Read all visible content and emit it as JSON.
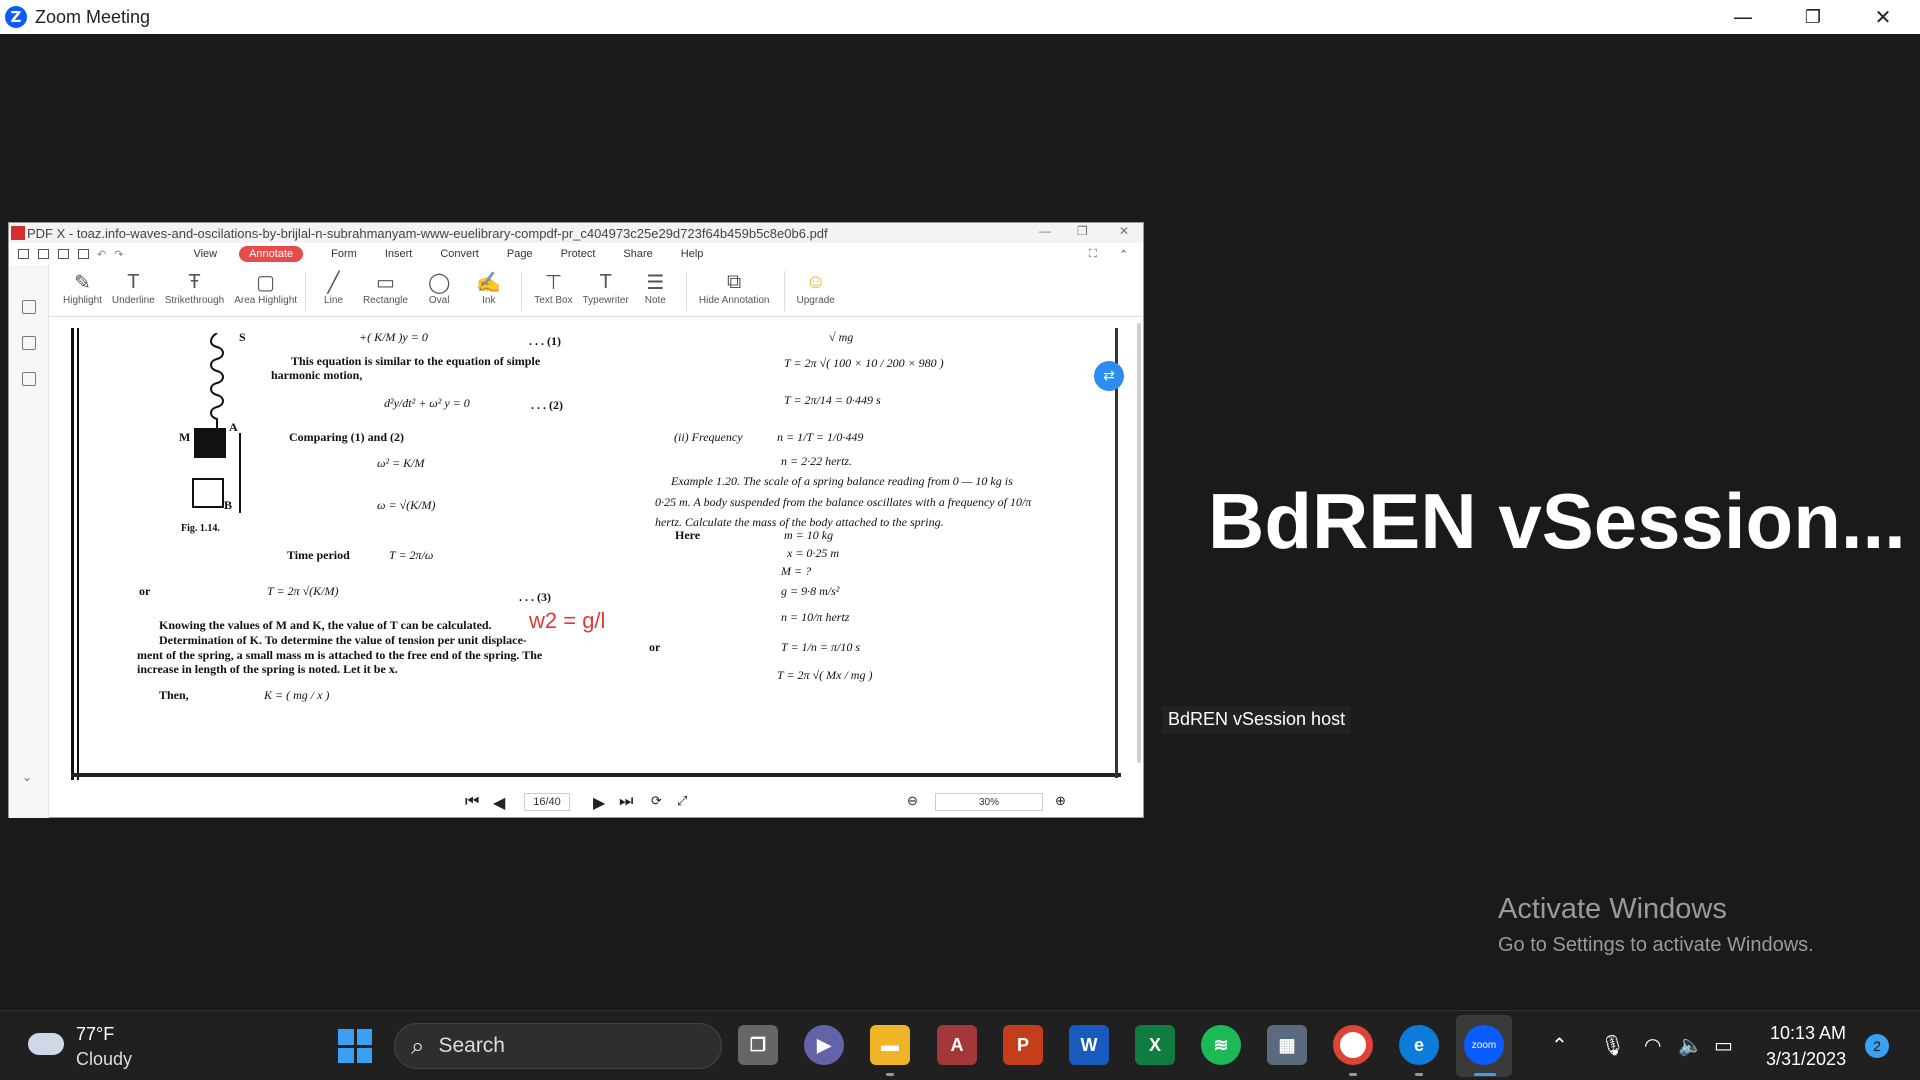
{
  "zoom": {
    "logo": "Z",
    "title": "Zoom Meeting",
    "minimize": "—",
    "restore": "❐",
    "close": "✕"
  },
  "pdf": {
    "title": "PDF X - toaz.info-waves-and-oscilations-by-brijlal-n-subrahmanyam-www-euelibrary-compdf-pr_c404973c25e29d723f64b459b5c8e0b6.pdf",
    "menu": [
      "View",
      "Annotate",
      "Form",
      "Insert",
      "Convert",
      "Page",
      "Protect",
      "Share",
      "Help"
    ],
    "tools": [
      "Highlight",
      "Underline",
      "Strikethrough",
      "Area Highlight",
      "Line",
      "Rectangle",
      "Oval",
      "Ink",
      "Text Box",
      "Typewriter",
      "Note",
      "Hide Annotation",
      "Upgrade"
    ],
    "page_indicator": "16/40",
    "zoom_level": "30%",
    "page": {
      "left": {
        "s_label": "S",
        "eq1_top": "+( K/M )y = 0",
        "eq1_ref": ". . . (1)",
        "line1": "This equation is similar to the equation of simple",
        "line2": "harmonic motion,",
        "eq2": "d²y/dt² + ω² y = 0",
        "eq2_ref": ". . . (2)",
        "m_label": "M",
        "a_label": "A",
        "comparing": "Comparing (1) and (2)",
        "omega_sq": "ω² = K/M",
        "omega": "ω = √(K/M)",
        "b_label": "B",
        "fig": "Fig. 1.14.",
        "time_period": "Time period",
        "t_eq": "T = 2π/ω",
        "or": "or",
        "t_eq2": "T = 2π √(K/M)",
        "eq3_ref": ". . . (3)",
        "handwritten": "w2 = g/l",
        "know": "Knowing the values of M and K, the value of T can be calculated.",
        "det": "Determination of K. To determine the value of tension per unit displace-",
        "ment": "ment of the spring, a small mass m is attached to the free end of the spring. The",
        "increase": "increase in length of the spring is noted. Let it be x.",
        "then": "Then,",
        "k_eq": "K = ( mg / x )"
      },
      "right": {
        "mg": "√ mg",
        "t1": "T = 2π √( 100 × 10 / 200 × 980 )",
        "t2": "T = 2π/14 = 0·449 s",
        "freq_label": "(ii) Frequency",
        "n1": "n = 1/T = 1/0·449",
        "n2": "n = 2·22 hertz.",
        "ex1": "Example 1.20. The scale of a spring balance reading from  0 — 10 kg is",
        "ex2": "0·25 m. A body suspended from the balance oscillates with a frequency of  10/π",
        "ex3": "hertz. Calculate the mass of the body attached to the spring.",
        "here": "Here",
        "m_val": "m = 10 kg",
        "x_val": "x = 0·25 m",
        "M_val": "M = ?",
        "g_val": "g = 9·8  m/s²",
        "n_val": "n = 10/π hertz",
        "or": "or",
        "t3": "T = 1/n = π/10 s",
        "t4": "T = 2π √( Mx / mg )"
      }
    }
  },
  "presenter": {
    "name": "BdREN  vSession...",
    "label": "BdREN vSession host"
  },
  "watermark": {
    "title": "Activate Windows",
    "subtitle": "Go to Settings to activate Windows."
  },
  "taskbar": {
    "weather_temp": "77°F",
    "weather_desc": "Cloudy",
    "search": "Search",
    "time": "10:13 AM",
    "date": "3/31/2023",
    "notifications": "2",
    "apps": {
      "access": "A",
      "powerpoint": "P",
      "word": "W",
      "excel": "X",
      "zoom": "zoom"
    }
  }
}
